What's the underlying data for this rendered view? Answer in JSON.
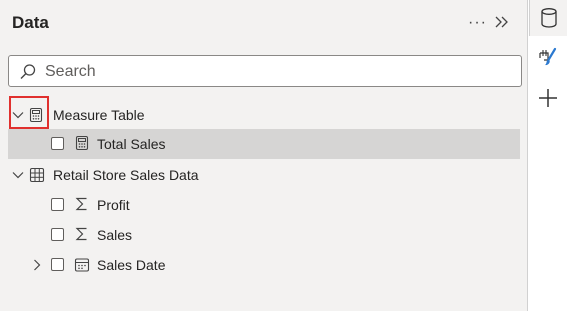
{
  "pane": {
    "title": "Data",
    "more_icon": "ellipsis-icon",
    "collapse_icon": "double-chevron-right-icon"
  },
  "search": {
    "placeholder": "Search",
    "value": "",
    "icon": "search-icon"
  },
  "tree": [
    {
      "label": "Measure Table",
      "type": "table-measure",
      "expanded": true
    },
    {
      "label": "Total Sales",
      "type": "measure",
      "checked": false,
      "selected": true
    },
    {
      "label": "Retail Store Sales Data",
      "type": "table",
      "expanded": true
    },
    {
      "label": "Profit",
      "type": "sum-field",
      "checked": false
    },
    {
      "label": "Sales",
      "type": "sum-field",
      "checked": false
    },
    {
      "label": "Sales Date",
      "type": "date-hierarchy",
      "checked": false,
      "expanded": false
    }
  ],
  "rail": {
    "items": [
      "data-cylinder-icon",
      "format-paintbrush-icon",
      "add-icon"
    ]
  },
  "colors": {
    "highlight": "#e0302e",
    "panel": "#f3f2f1",
    "selected_row": "#d6d5d4"
  }
}
